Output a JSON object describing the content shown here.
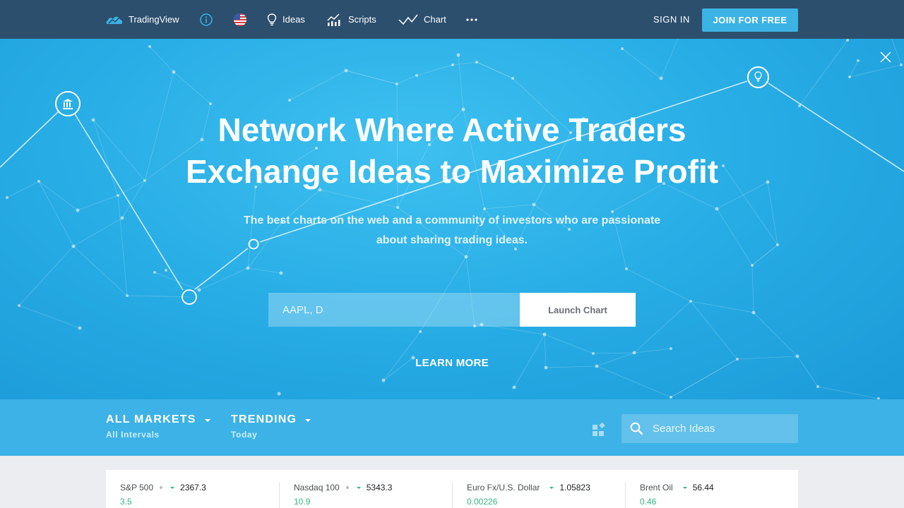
{
  "nav": {
    "brand": "TradingView",
    "ideas": "Ideas",
    "scripts": "Scripts",
    "chart": "Chart",
    "signin": "SIGN IN",
    "join": "JOIN FOR FREE"
  },
  "hero": {
    "title_line1": "Network Where Active Traders",
    "title_line2": "Exchange Ideas to Maximize Profit",
    "subtitle_line1": "The best charts on the web and a community of investors who are passionate",
    "subtitle_line2": "about sharing trading ideas.",
    "symbol_placeholder": "AAPL, D",
    "launch": "Launch Chart",
    "learn_more": "LEARN MORE"
  },
  "filters": {
    "markets": {
      "title": "ALL MARKETS",
      "sub": "All Intervals"
    },
    "trending": {
      "title": "TRENDING",
      "sub": "Today"
    },
    "search_placeholder": "Search Ideas"
  },
  "ticker": [
    {
      "name": "S&P 500",
      "price": "2367.3",
      "change": "3.5"
    },
    {
      "name": "Nasdaq 100",
      "price": "5343.3",
      "change": "10.9"
    },
    {
      "name": "Euro Fx/U.S. Dollar",
      "price": "1.05823",
      "change": "0.00226"
    },
    {
      "name": "Brent Oil",
      "price": "56.44",
      "change": "0.46"
    }
  ],
  "colors": {
    "navbar": "#2c4f6e",
    "accent": "#3bb3e4",
    "hero": "#29aee6",
    "positive": "#33b682"
  }
}
